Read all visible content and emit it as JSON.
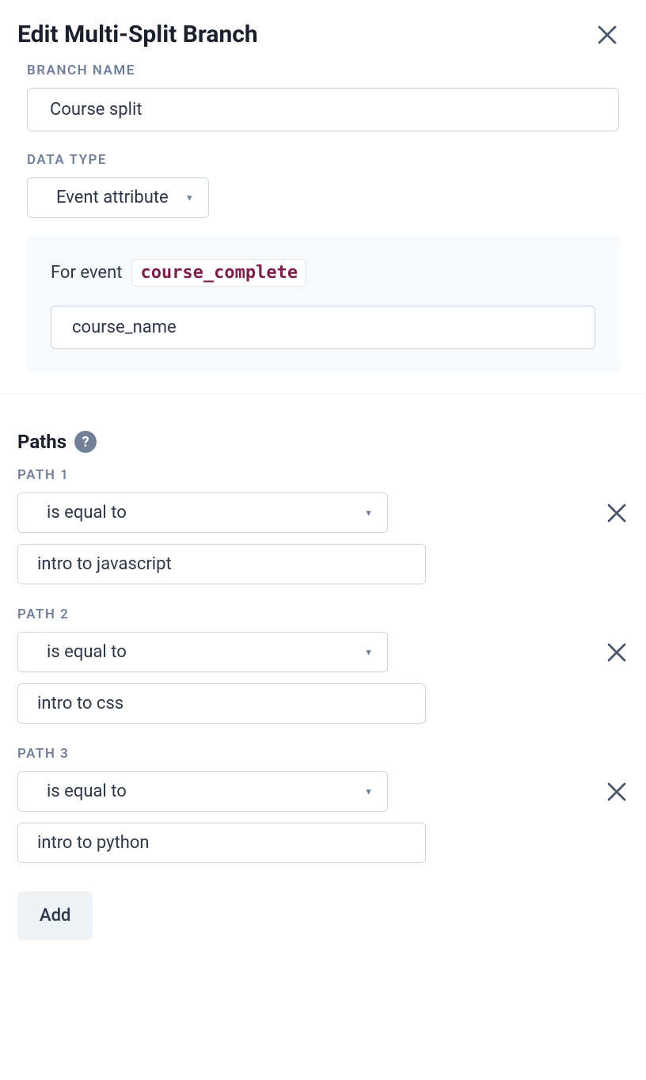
{
  "header": {
    "title": "Edit Multi-Split Branch"
  },
  "branch": {
    "label": "BRANCH NAME",
    "value": "Course split"
  },
  "data_type": {
    "label": "DATA TYPE",
    "value": "Event attribute"
  },
  "event_card": {
    "for_event_label": "For event",
    "event_name": "course_complete",
    "attribute_value": "course_name"
  },
  "paths": {
    "title": "Paths",
    "items": [
      {
        "label": "PATH 1",
        "condition": "is equal to",
        "value": "intro to javascript"
      },
      {
        "label": "PATH 2",
        "condition": "is equal to",
        "value": "intro to css"
      },
      {
        "label": "PATH 3",
        "condition": "is equal to",
        "value": "intro to python"
      }
    ],
    "add_label": "Add"
  }
}
